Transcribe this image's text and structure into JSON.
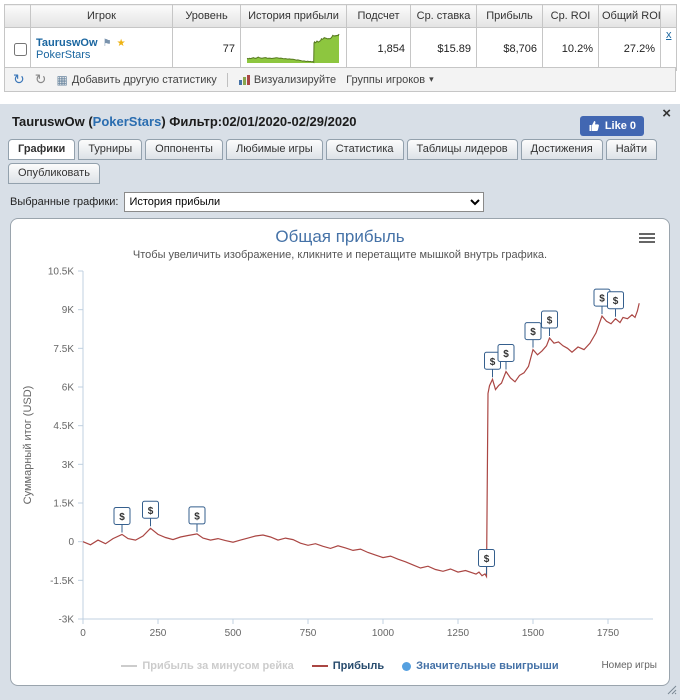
{
  "table": {
    "headers": [
      "",
      "Игрок",
      "Уровень",
      "История прибыли",
      "Подсчет",
      "Ср. ставка",
      "Прибыль",
      "Ср. ROI",
      "Общий ROI",
      ""
    ],
    "row": {
      "player": "TauruswOw",
      "site": "PokerStars",
      "level": "77",
      "count": "1,854",
      "avg_stake": "$15.89",
      "profit": "$8,706",
      "avg_roi": "10.2%",
      "total_roi": "27.2%",
      "close": "x"
    }
  },
  "toolbar": {
    "add_stat": "Добавить другую статистику",
    "visualize": "Визуализируйте",
    "groups": "Группы игроков",
    "caret": "▾"
  },
  "panel": {
    "title_player": "TauruswOw (",
    "title_site": "PokerStars",
    "title_rest": ") Фильтр:02/01/2020-02/29/2020",
    "like": "Like 0",
    "close": "×",
    "tabs": [
      "Графики",
      "Турниры",
      "Оппоненты",
      "Любимые игры",
      "Статистика",
      "Таблицы лидеров",
      "Достижения",
      "Найти"
    ],
    "tabs_row2": [
      "Опубликовать"
    ],
    "active_tab": "Графики",
    "select_label": "Выбранные графики:",
    "select_value": "История прибыли"
  },
  "chart_data": {
    "type": "line",
    "title": "Общая прибыль",
    "subtitle": "Чтобы увеличить изображение, кликните и перетащите мышкой внутрь графика.",
    "ylabel": "Суммарный итог (USD)",
    "xlabel": "Номер игры",
    "xlim": [
      0,
      1900
    ],
    "ylim": [
      -3000,
      10500
    ],
    "xticks": [
      0,
      250,
      500,
      750,
      1000,
      1250,
      1500,
      1750
    ],
    "yticks": [
      {
        "v": -3000,
        "label": "-3K"
      },
      {
        "v": -1500,
        "label": "-1.5K"
      },
      {
        "v": 0,
        "label": "0"
      },
      {
        "v": 1500,
        "label": "1.5K"
      },
      {
        "v": 3000,
        "label": "3K"
      },
      {
        "v": 4500,
        "label": "4.5K"
      },
      {
        "v": 6000,
        "label": "6K"
      },
      {
        "v": 7500,
        "label": "7.5K"
      },
      {
        "v": 9000,
        "label": "9K"
      },
      {
        "v": 10500,
        "label": "10.5K"
      }
    ],
    "x": [
      0,
      25,
      50,
      75,
      100,
      130,
      150,
      175,
      200,
      225,
      250,
      275,
      300,
      325,
      350,
      380,
      400,
      425,
      450,
      475,
      500,
      525,
      550,
      575,
      600,
      625,
      650,
      675,
      700,
      725,
      750,
      775,
      800,
      825,
      850,
      875,
      900,
      925,
      950,
      975,
      1000,
      1025,
      1050,
      1075,
      1100,
      1125,
      1150,
      1175,
      1200,
      1225,
      1250,
      1275,
      1300,
      1310,
      1320,
      1330,
      1340,
      1345,
      1350,
      1355,
      1365,
      1375,
      1385,
      1395,
      1410,
      1425,
      1440,
      1455,
      1470,
      1485,
      1500,
      1515,
      1530,
      1545,
      1555,
      1570,
      1585,
      1600,
      1615,
      1630,
      1650,
      1670,
      1690,
      1710,
      1730,
      1745,
      1760,
      1775,
      1790,
      1800,
      1815,
      1830,
      1840,
      1848,
      1854
    ],
    "series": [
      {
        "name": "Прибыль за минусом рейка",
        "color": "#CCCCCC",
        "visible": false,
        "values": []
      },
      {
        "name": "Прибыль",
        "color": "#AA4643",
        "visible": true,
        "values": [
          0,
          -120,
          60,
          -80,
          120,
          280,
          120,
          60,
          220,
          520,
          280,
          160,
          80,
          180,
          240,
          300,
          140,
          60,
          120,
          40,
          -20,
          60,
          140,
          220,
          260,
          180,
          60,
          140,
          80,
          -60,
          -140,
          -80,
          -180,
          -260,
          -160,
          -240,
          -340,
          -290,
          -420,
          -520,
          -620,
          -560,
          -680,
          -780,
          -900,
          -1020,
          -950,
          -1080,
          -1150,
          -1060,
          -1180,
          -1120,
          -1220,
          -1260,
          -1180,
          -1320,
          -1250,
          -1350,
          5750,
          6050,
          6300,
          5900,
          6050,
          6150,
          6600,
          6350,
          6200,
          6450,
          6550,
          6800,
          7450,
          7250,
          7400,
          7600,
          7900,
          7700,
          7750,
          7600,
          7500,
          7350,
          7550,
          7450,
          7700,
          8100,
          8750,
          8550,
          8450,
          8650,
          8500,
          8700,
          8650,
          8800,
          8700,
          8950,
          9250
        ]
      }
    ],
    "significant_wins": {
      "name": "Значительные выигрыши",
      "color": "#55A0E0",
      "symbol": "$",
      "points": [
        [
          130,
          280
        ],
        [
          225,
          520
        ],
        [
          380,
          300
        ],
        [
          1345,
          -1350
        ],
        [
          1365,
          6300
        ],
        [
          1410,
          6600
        ],
        [
          1500,
          7450
        ],
        [
          1555,
          7900
        ],
        [
          1730,
          8750
        ],
        [
          1775,
          8650
        ]
      ]
    },
    "legend": [
      {
        "label": "Прибыль за минусом рейка",
        "swatch": "line",
        "color": "#CCCCCC",
        "text_color": "#CCCCCC"
      },
      {
        "label": "Прибыль",
        "swatch": "line",
        "color": "#AA4643",
        "text_color": "#274B6D"
      },
      {
        "label": "Значительные выигрыши",
        "swatch": "circle",
        "color": "#55A0E0",
        "text_color": "#4572A7"
      }
    ]
  }
}
